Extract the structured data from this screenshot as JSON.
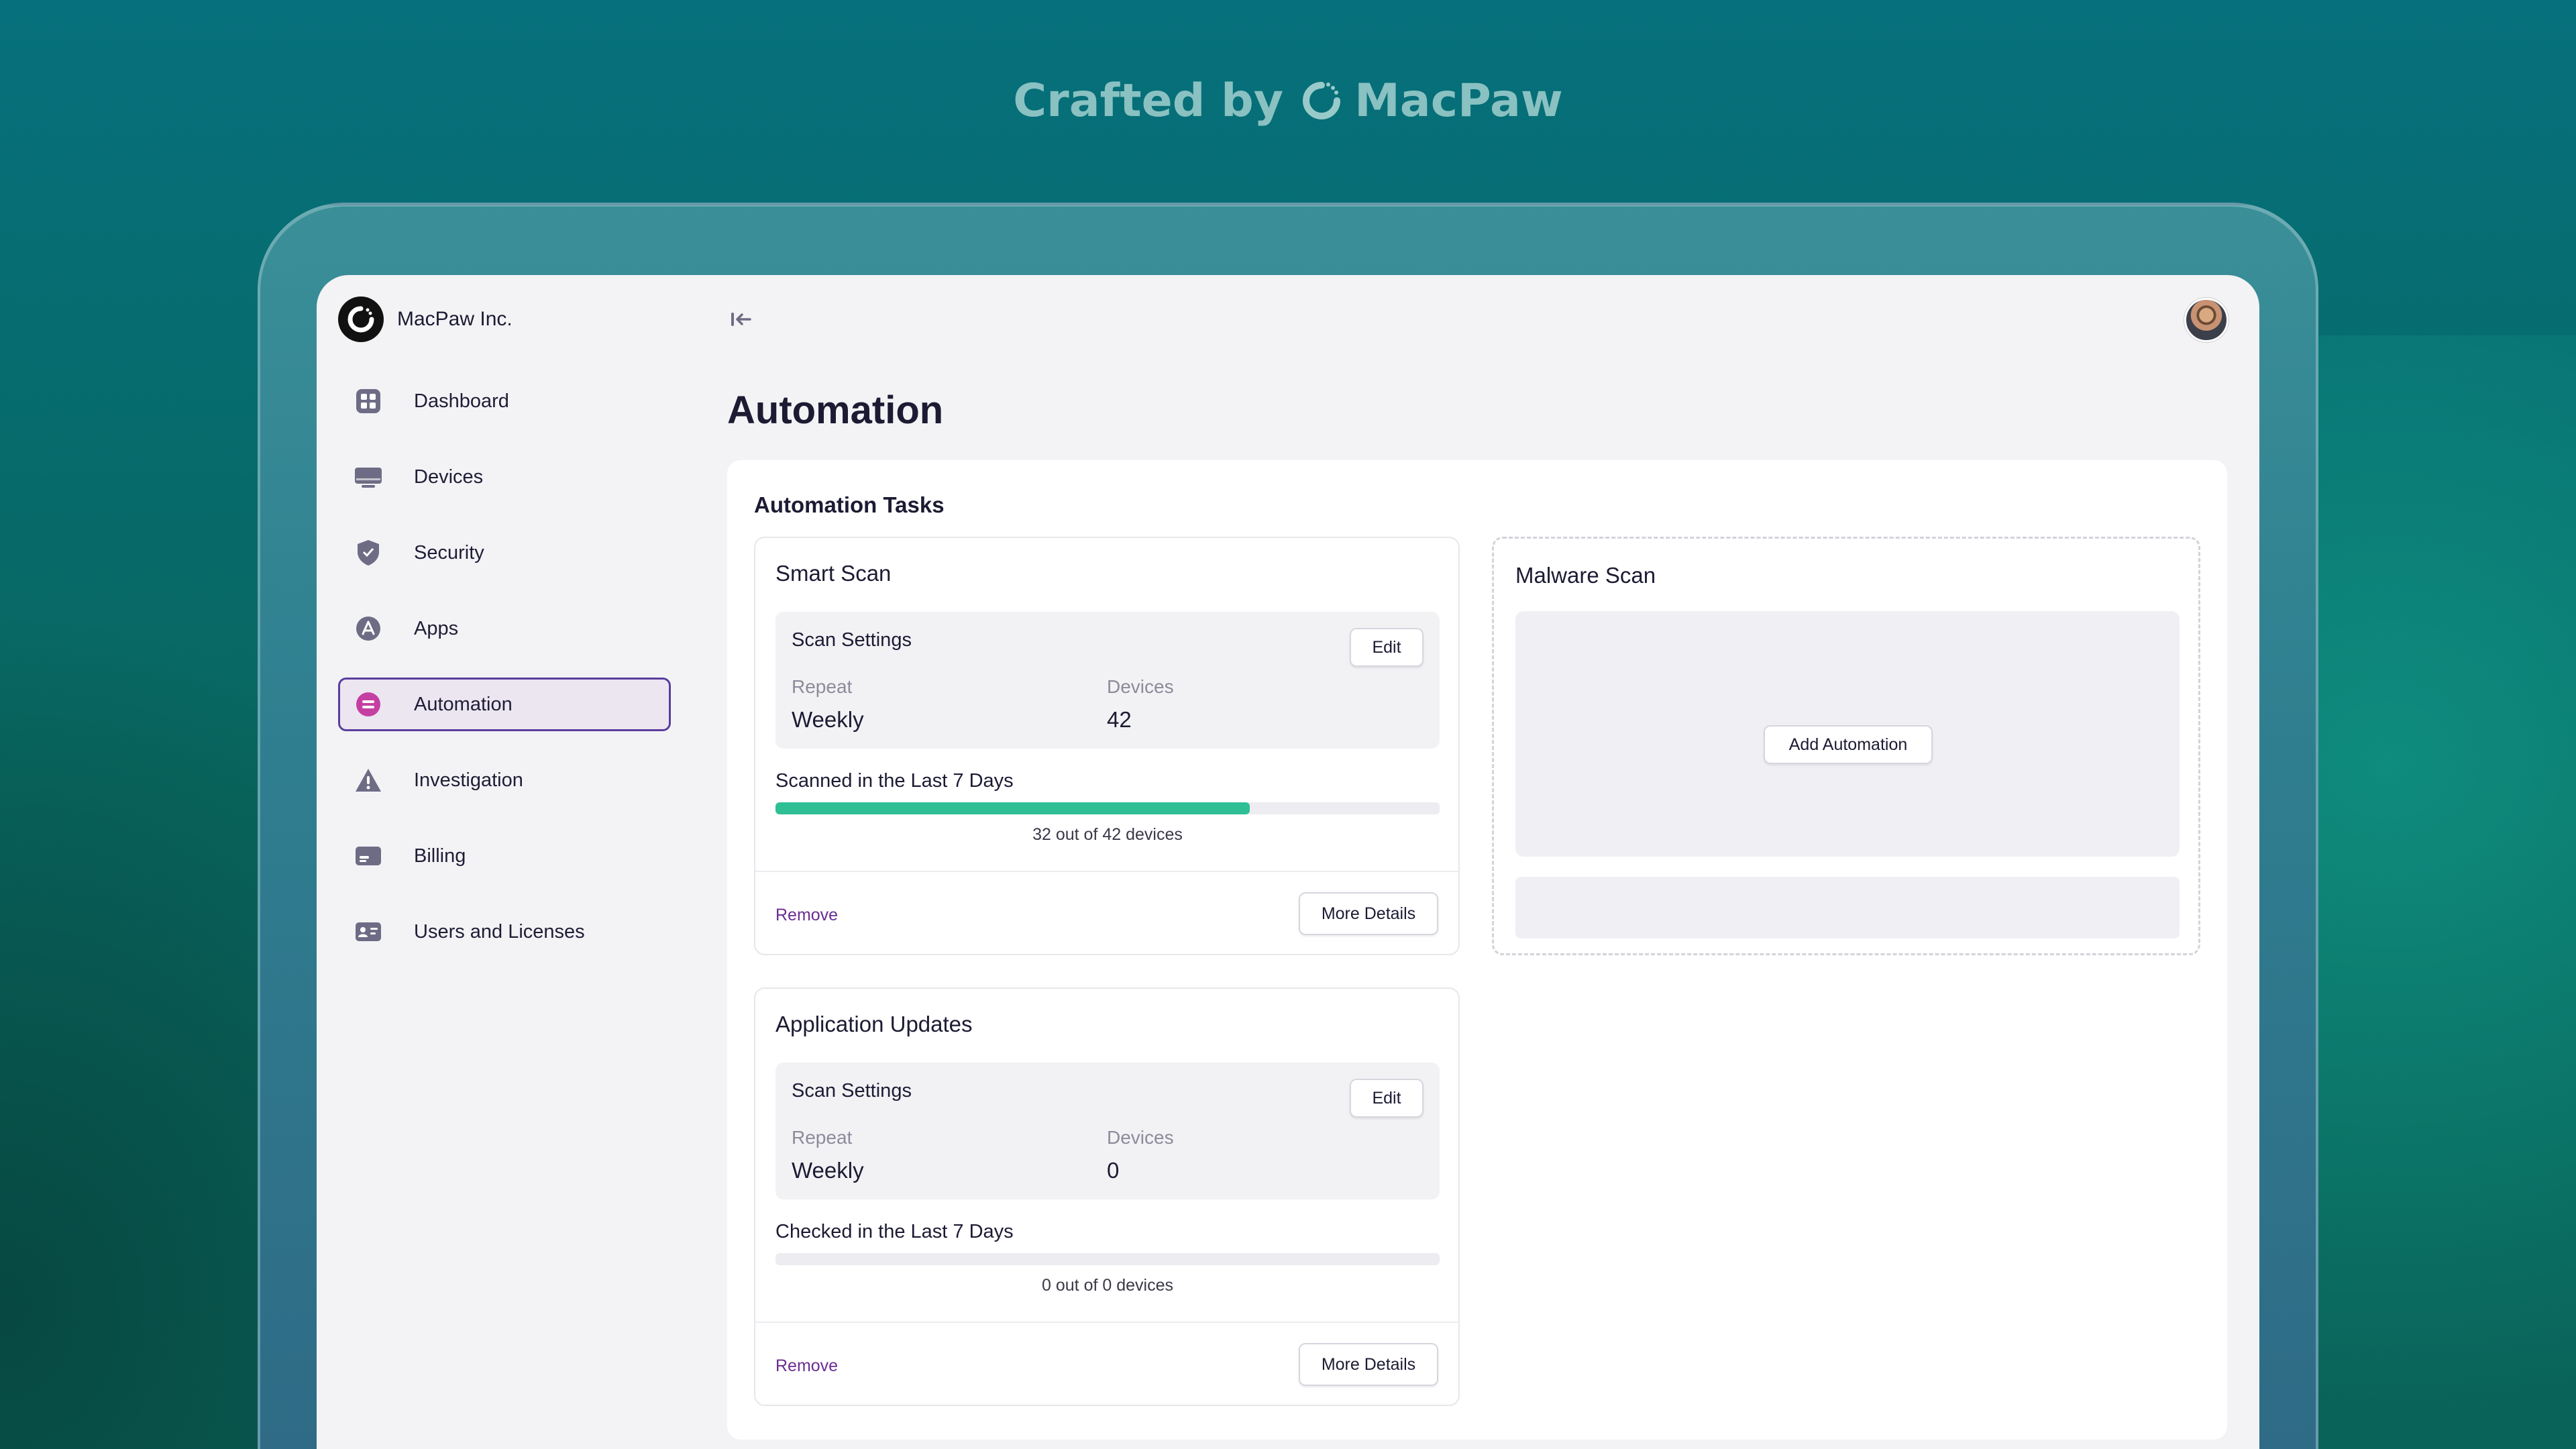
{
  "banner": {
    "prefix": "Crafted by",
    "brand": "MacPaw"
  },
  "org": {
    "name": "MacPaw Inc."
  },
  "sidebar": {
    "items": [
      {
        "label": "Dashboard",
        "icon": "dashboard-icon",
        "active": false
      },
      {
        "label": "Devices",
        "icon": "devices-icon",
        "active": false
      },
      {
        "label": "Security",
        "icon": "shield-icon",
        "active": false
      },
      {
        "label": "Apps",
        "icon": "apps-icon",
        "active": false
      },
      {
        "label": "Automation",
        "icon": "automation-icon",
        "active": true
      },
      {
        "label": "Investigation",
        "icon": "warning-icon",
        "active": false
      },
      {
        "label": "Billing",
        "icon": "billing-icon",
        "active": false
      },
      {
        "label": "Users and Licenses",
        "icon": "users-icon",
        "active": false
      }
    ]
  },
  "page": {
    "title": "Automation"
  },
  "panel": {
    "title": "Automation Tasks"
  },
  "tasks": [
    {
      "title": "Smart Scan",
      "settings_title": "Scan Settings",
      "edit_label": "Edit",
      "repeat_label": "Repeat",
      "repeat_value": "Weekly",
      "devices_label": "Devices",
      "devices_value": "42",
      "progress_label": "Scanned in the Last 7 Days",
      "progress_fraction": 0.7143,
      "progress_caption": "32 out of 42 devices",
      "remove_label": "Remove",
      "details_label": "More Details"
    },
    {
      "title": "Application Updates",
      "settings_title": "Scan Settings",
      "edit_label": "Edit",
      "repeat_label": "Repeat",
      "repeat_value": "Weekly",
      "devices_label": "Devices",
      "devices_value": "0",
      "progress_label": "Checked in the Last 7 Days",
      "progress_fraction": 0,
      "progress_caption": "0 out of 0 devices",
      "remove_label": "Remove",
      "details_label": "More Details"
    }
  ],
  "empty_task": {
    "title": "Malware Scan",
    "add_label": "Add Automation"
  },
  "colors": {
    "accent": "#5b3e9e",
    "progress": "#2fbf95",
    "link": "#6a2d91"
  }
}
